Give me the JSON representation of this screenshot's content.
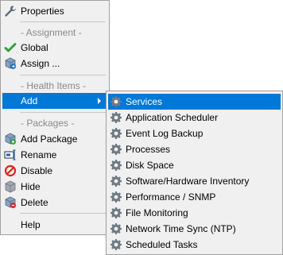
{
  "menu": {
    "properties": "Properties",
    "assignment_header": "- Assignment -",
    "global": "Global",
    "assign": "Assign ...",
    "health_header": "- Health Items -",
    "add": "Add",
    "packages_header": "- Packages -",
    "add_package": "Add Package",
    "rename": "Rename",
    "disable": "Disable",
    "hide": "Hide",
    "delete": "Delete",
    "help": "Help"
  },
  "submenu": {
    "items": [
      {
        "label": "Services"
      },
      {
        "label": "Application Scheduler"
      },
      {
        "label": "Event Log Backup"
      },
      {
        "label": "Processes"
      },
      {
        "label": "Disk Space"
      },
      {
        "label": "Software/Hardware Inventory"
      },
      {
        "label": "Performance / SNMP"
      },
      {
        "label": "File Monitoring"
      },
      {
        "label": "Network Time Sync (NTP)"
      },
      {
        "label": "Scheduled Tasks"
      }
    ]
  },
  "colors": {
    "highlight": "#0078d7",
    "menu_background": "#f0f0f0",
    "group_header_text": "#8a8a8a",
    "check_green": "#2e9d3a",
    "disable_red": "#d9261c"
  },
  "icons": {
    "properties": "wrench-icon",
    "global": "checkmark-icon",
    "assign": "package-assign-icon",
    "add_package": "package-add-icon",
    "rename": "rename-icon",
    "disable": "disable-icon",
    "hide": "package-hide-icon",
    "delete": "package-delete-icon",
    "health_item": "gear-icon",
    "add_submenu": "submenu-arrow-icon"
  }
}
